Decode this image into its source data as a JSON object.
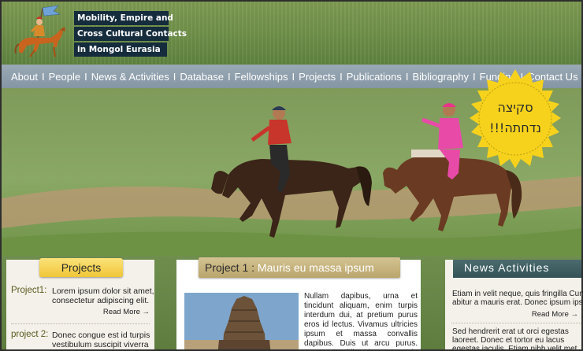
{
  "header": {
    "title_lines": [
      "Mobility, Empire and",
      "Cross Cultural Contacts",
      "in Mongol Eurasia"
    ],
    "logo_icon": "horseman-with-banner-icon"
  },
  "nav": {
    "items": [
      "About",
      "People",
      "News & Activities",
      "Database",
      "Fellowships",
      "Projects",
      "Publications",
      "Bibliography",
      "Funding",
      "Contact Us"
    ],
    "separator": "I"
  },
  "badge": {
    "line1": "סקיצה",
    "line2": "נדחתה!!!",
    "color": "#f6d21c"
  },
  "projects": {
    "heading": "Projects",
    "items": [
      {
        "label": "Project1:",
        "text": "Lorem ipsum dolor sit amet, consectetur adipiscing elit.",
        "more": "Read More →"
      },
      {
        "label": "project 2:",
        "text": "Donec congue est id turpis vestibulum suscipit viverra",
        "more": ""
      }
    ]
  },
  "center": {
    "heading_part1": "Project 1 : ",
    "heading_part2": "Mauris eu massa ipsum",
    "body": "Nullam dapibus, urna et tincidunt aliquam, enim turpis interdum dui, at pretium purus eros id lectus. Vivamus ultricies ipsum et massa convallis dapibus. Duis ut arcu purus. Maecenas bibendum tortor in nibh viverra"
  },
  "news": {
    "heading": "News Activities",
    "items": [
      {
        "line1": "Etiam in velit neque, quis fringilla Cur",
        "line2": "abitur a mauris erat. Donec ipsum ipsum"
      },
      {
        "line1": "Sed hendrerit erat ut orci egestas",
        "line2": "laoreet. Donec et tortor eu lacus",
        "line3": "egestas iaculis. Etiam nibh velit met"
      }
    ],
    "more": "Read More →"
  },
  "colors": {
    "nav_bg": "#8a9aa8",
    "title_bg": "#152c3d",
    "projects_tab": "#f0c637",
    "news_tab": "#3d5c60"
  }
}
